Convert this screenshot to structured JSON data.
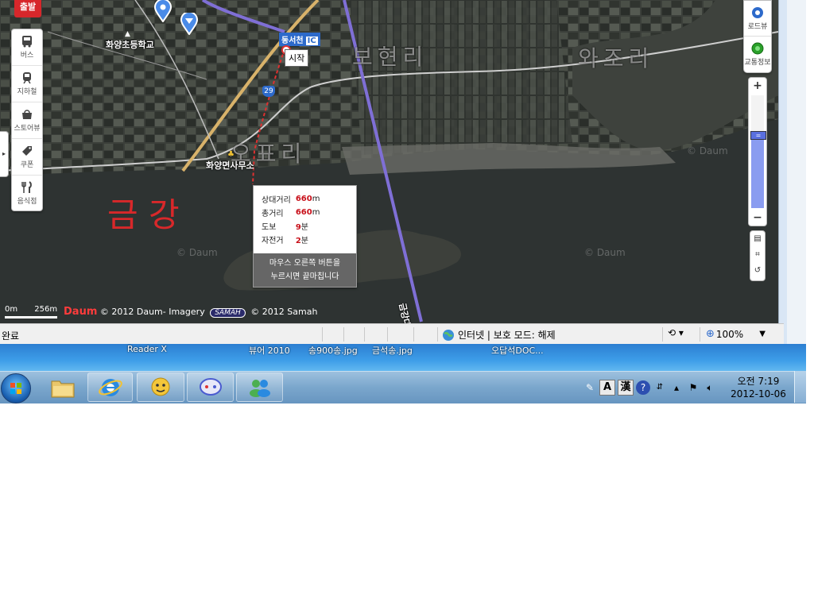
{
  "map": {
    "place_names": {
      "bohyeon": "보현리",
      "wajo": "와조리",
      "opyo": "오표리",
      "school": "화양초등학교",
      "office": "화양면사무소",
      "river_bridge": "금강대교"
    },
    "watermark": "© Daum",
    "route_shield": "29",
    "ic_label": "동서천",
    "ic_tag": "IC",
    "start_tag": "시작",
    "handwriting": "금 강"
  },
  "toolbar": {
    "start_badge": "출발",
    "items": [
      {
        "label": "버스",
        "icon": "bus-icon"
      },
      {
        "label": "지하철",
        "icon": "subway-icon"
      },
      {
        "label": "스토어뷰",
        "icon": "store-icon"
      },
      {
        "label": "쿠폰",
        "icon": "coupon-icon"
      },
      {
        "label": "음식점",
        "icon": "restaurant-icon"
      }
    ]
  },
  "right_controls": {
    "roadview": "로드뷰",
    "traffic": "교통정보",
    "zoom_in": "+",
    "zoom_out": "−",
    "zoom_level_fraction": 0.65
  },
  "distance_popup": {
    "rows": [
      {
        "label": "상대거리",
        "value": "660",
        "unit": "m"
      },
      {
        "label": "총거리",
        "value": "660",
        "unit": "m"
      },
      {
        "label": "도보",
        "value": "9",
        "unit": "분"
      },
      {
        "label": "자전거",
        "value": "2",
        "unit": "분"
      }
    ],
    "hint_line1": "마우스 오른쪽 버튼을",
    "hint_line2": "누르시면 끝마칩니다"
  },
  "scale": {
    "zero": "0m",
    "distance": "256m"
  },
  "copyright": {
    "daum_logo": "Daum",
    "daum_text": "© 2012 Daum- Imagery",
    "samah_logo": "SAMAH",
    "samah_text": "© 2012 Samah"
  },
  "statusbar": {
    "status": "완료",
    "zone": "인터넷 | 보호 모드: 해제",
    "zoom": "100%"
  },
  "desktop": {
    "labels": [
      "Reader X",
      "뷰어 2010",
      "송900송.jpg",
      "금석송.jpg",
      "오답석DOC..."
    ]
  },
  "taskbar": {
    "time": "오전 7:19",
    "date": "2012-10-06",
    "ime_a": "A",
    "ime_han": "漢"
  },
  "colors": {
    "route": "#7f6fd6",
    "accent_red": "#c8101a",
    "start_red": "#d7272b",
    "handwriting": "#d8282a"
  }
}
